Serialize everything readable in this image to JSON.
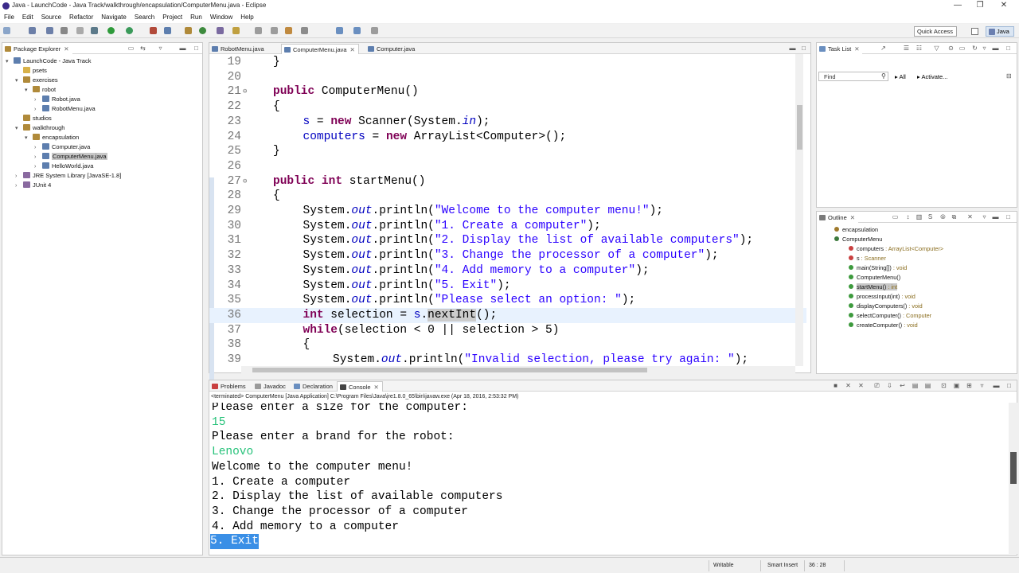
{
  "window": {
    "title": "Java - LaunchCode - Java Track/walkthrough/encapsulation/ComputerMenu.java - Eclipse",
    "minimize": "—",
    "maximize": "❐",
    "close": "✕"
  },
  "menu": [
    "File",
    "Edit",
    "Source",
    "Refactor",
    "Navigate",
    "Search",
    "Project",
    "Run",
    "Window",
    "Help"
  ],
  "toolbar": {
    "quick_access": "Quick Access",
    "perspective": "Java"
  },
  "package_explorer": {
    "title": "Package Explorer",
    "tree": [
      {
        "label": "LaunchCode - Java Track",
        "level": 0,
        "arrow": "▾",
        "icon": "project-icon"
      },
      {
        "label": "psets",
        "level": 1,
        "arrow": "",
        "icon": "folder-icon"
      },
      {
        "label": "exercises",
        "level": 1,
        "arrow": "▾",
        "icon": "package-icon"
      },
      {
        "label": "robot",
        "level": 2,
        "arrow": "▾",
        "icon": "package-icon"
      },
      {
        "label": "Robot.java",
        "level": 3,
        "arrow": "›",
        "icon": "java-file-icon"
      },
      {
        "label": "RobotMenu.java",
        "level": 3,
        "arrow": "›",
        "icon": "java-file-icon"
      },
      {
        "label": "studios",
        "level": 1,
        "arrow": "",
        "icon": "package-icon"
      },
      {
        "label": "walkthrough",
        "level": 1,
        "arrow": "▾",
        "icon": "package-icon"
      },
      {
        "label": "encapsulation",
        "level": 2,
        "arrow": "▾",
        "icon": "package-icon"
      },
      {
        "label": "Computer.java",
        "level": 3,
        "arrow": "›",
        "icon": "java-file-icon"
      },
      {
        "label": "ComputerMenu.java",
        "level": 3,
        "arrow": "›",
        "icon": "java-file-icon",
        "selected": true
      },
      {
        "label": "HelloWorld.java",
        "level": 3,
        "arrow": "›",
        "icon": "java-file-icon"
      },
      {
        "label": "JRE System Library [JavaSE-1.8]",
        "level": 1,
        "arrow": "›",
        "icon": "library-icon"
      },
      {
        "label": "JUnit 4",
        "level": 1,
        "arrow": "›",
        "icon": "library-icon"
      }
    ]
  },
  "editor": {
    "tabs": [
      {
        "label": "RobotMenu.java",
        "active": false
      },
      {
        "label": "ComputerMenu.java",
        "active": true
      },
      {
        "label": "Computer.java",
        "active": false
      }
    ],
    "lines": [
      {
        "n": "19",
        "fold": "",
        "indent": 0,
        "tokens": [
          [
            "",
            "}"
          ]
        ]
      },
      {
        "n": "20",
        "fold": "",
        "indent": 0,
        "tokens": []
      },
      {
        "n": "21",
        "fold": "⊖",
        "indent": 0,
        "tokens": [
          [
            "kw",
            "public"
          ],
          [
            "",
            " ComputerMenu()"
          ]
        ]
      },
      {
        "n": "22",
        "fold": "",
        "indent": 0,
        "tokens": [
          [
            "",
            "{"
          ]
        ]
      },
      {
        "n": "23",
        "fold": "",
        "indent": 1,
        "tokens": [
          [
            "fld",
            "s"
          ],
          [
            "",
            " = "
          ],
          [
            "kw",
            "new"
          ],
          [
            "",
            " Scanner(System."
          ],
          [
            "sfld",
            "in"
          ],
          [
            "",
            ");"
          ]
        ]
      },
      {
        "n": "24",
        "fold": "",
        "indent": 1,
        "tokens": [
          [
            "fld",
            "computers"
          ],
          [
            "",
            " = "
          ],
          [
            "kw",
            "new"
          ],
          [
            "",
            " ArrayList<Computer>();"
          ]
        ]
      },
      {
        "n": "25",
        "fold": "",
        "indent": 0,
        "tokens": [
          [
            "",
            "}"
          ]
        ]
      },
      {
        "n": "26",
        "fold": "",
        "indent": 0,
        "tokens": []
      },
      {
        "n": "27",
        "fold": "⊖",
        "indent": 0,
        "tokens": [
          [
            "kw",
            "public"
          ],
          [
            "",
            " "
          ],
          [
            "kw",
            "int"
          ],
          [
            "",
            " startMenu()"
          ]
        ]
      },
      {
        "n": "28",
        "fold": "",
        "indent": 0,
        "tokens": [
          [
            "",
            "{"
          ]
        ]
      },
      {
        "n": "29",
        "fold": "",
        "indent": 1,
        "tokens": [
          [
            "",
            "System."
          ],
          [
            "sfld",
            "out"
          ],
          [
            "",
            ".println("
          ],
          [
            "str",
            "\"Welcome to the computer menu!\""
          ],
          [
            "",
            ");"
          ]
        ]
      },
      {
        "n": "30",
        "fold": "",
        "indent": 1,
        "tokens": [
          [
            "",
            "System."
          ],
          [
            "sfld",
            "out"
          ],
          [
            "",
            ".println("
          ],
          [
            "str",
            "\"1. Create a computer\""
          ],
          [
            "",
            ");"
          ]
        ]
      },
      {
        "n": "31",
        "fold": "",
        "indent": 1,
        "tokens": [
          [
            "",
            "System."
          ],
          [
            "sfld",
            "out"
          ],
          [
            "",
            ".println("
          ],
          [
            "str",
            "\"2. Display the list of available computers\""
          ],
          [
            "",
            ");"
          ]
        ]
      },
      {
        "n": "32",
        "fold": "",
        "indent": 1,
        "tokens": [
          [
            "",
            "System."
          ],
          [
            "sfld",
            "out"
          ],
          [
            "",
            ".println("
          ],
          [
            "str",
            "\"3. Change the processor of a computer\""
          ],
          [
            "",
            ");"
          ]
        ]
      },
      {
        "n": "33",
        "fold": "",
        "indent": 1,
        "tokens": [
          [
            "",
            "System."
          ],
          [
            "sfld",
            "out"
          ],
          [
            "",
            ".println("
          ],
          [
            "str",
            "\"4. Add memory to a computer\""
          ],
          [
            "",
            ");"
          ]
        ]
      },
      {
        "n": "34",
        "fold": "",
        "indent": 1,
        "tokens": [
          [
            "",
            "System."
          ],
          [
            "sfld",
            "out"
          ],
          [
            "",
            ".println("
          ],
          [
            "str",
            "\"5. Exit\""
          ],
          [
            "",
            ");"
          ]
        ]
      },
      {
        "n": "35",
        "fold": "",
        "indent": 1,
        "tokens": [
          [
            "",
            "System."
          ],
          [
            "sfld",
            "out"
          ],
          [
            "",
            ".println("
          ],
          [
            "str",
            "\"Please select an option: \""
          ],
          [
            "",
            ");"
          ]
        ]
      },
      {
        "n": "36",
        "fold": "",
        "indent": 1,
        "current": true,
        "tokens": [
          [
            "kw",
            "int"
          ],
          [
            "",
            " selection = "
          ],
          [
            "fld",
            "s"
          ],
          [
            "",
            "."
          ],
          [
            "occ",
            "nextInt"
          ],
          [
            "",
            "();"
          ]
        ]
      },
      {
        "n": "37",
        "fold": "",
        "indent": 1,
        "tokens": [
          [
            "kw",
            "while"
          ],
          [
            "",
            "(selection < 0 || selection > 5)"
          ]
        ]
      },
      {
        "n": "38",
        "fold": "",
        "indent": 1,
        "tokens": [
          [
            "",
            "{"
          ]
        ]
      },
      {
        "n": "39",
        "fold": "",
        "indent": 2,
        "tokens": [
          [
            "",
            "System."
          ],
          [
            "sfld",
            "out"
          ],
          [
            "",
            ".println("
          ],
          [
            "str",
            "\"Invalid selection, please try again: \""
          ],
          [
            "",
            ");"
          ]
        ]
      }
    ]
  },
  "task_list": {
    "title": "Task List",
    "find_placeholder": "Find",
    "all": "All",
    "activate": "Activate..."
  },
  "outline": {
    "title": "Outline",
    "items": [
      {
        "label": "encapsulation",
        "type": "",
        "color": "#a07a2c",
        "level": 0
      },
      {
        "label": "ComputerMenu",
        "type": "",
        "color": "#3d7a3d",
        "level": 0
      },
      {
        "label": "computers",
        "type": " : ArrayList<Computer>",
        "color": "#c94040",
        "level": 1
      },
      {
        "label": "s",
        "type": " : Scanner",
        "color": "#c94040",
        "level": 1
      },
      {
        "label": "main(String[])",
        "type": " : void",
        "color": "#3d9a3d",
        "level": 1
      },
      {
        "label": "ComputerMenu()",
        "type": "",
        "color": "#3d9a3d",
        "level": 1
      },
      {
        "label": "startMenu()",
        "type": " : int",
        "color": "#3d9a3d",
        "level": 1,
        "selected": true
      },
      {
        "label": "processInput(int)",
        "type": " : void",
        "color": "#3d9a3d",
        "level": 1
      },
      {
        "label": "displayComputers()",
        "type": " : void",
        "color": "#3d9a3d",
        "level": 1
      },
      {
        "label": "selectComputer()",
        "type": " : Computer",
        "color": "#3d9a3d",
        "level": 1
      },
      {
        "label": "createComputer()",
        "type": " : void",
        "color": "#3d9a3d",
        "level": 1
      }
    ]
  },
  "bottom_panel": {
    "tabs": [
      {
        "label": "Problems",
        "active": false
      },
      {
        "label": "Javadoc",
        "active": false
      },
      {
        "label": "Declaration",
        "active": false
      },
      {
        "label": "Console",
        "active": true
      }
    ],
    "console_header": "<terminated> ComputerMenu [Java Application] C:\\Program Files\\Java\\jre1.8.0_65\\bin\\javaw.exe (Apr 18, 2016, 2:53:32 PM)",
    "console_lines": [
      {
        "text": "Please enter a size for the computer:",
        "kind": "out"
      },
      {
        "text": "15",
        "kind": "input"
      },
      {
        "text": "Please enter a brand for the robot:",
        "kind": "out"
      },
      {
        "text": "Lenovo",
        "kind": "input"
      },
      {
        "text": "Welcome to the computer menu!",
        "kind": "out"
      },
      {
        "text": "1. Create a computer",
        "kind": "out"
      },
      {
        "text": "2. Display the list of available computers",
        "kind": "out"
      },
      {
        "text": "3. Change the processor of a computer",
        "kind": "out"
      },
      {
        "text": "4. Add memory to a computer",
        "kind": "out"
      },
      {
        "text": "5. Exit",
        "kind": "highlight"
      }
    ]
  },
  "status": {
    "writable": "Writable",
    "insert_mode": "Smart Insert",
    "position": "36 : 28"
  },
  "colors": {
    "keyword": "#7f0055",
    "string": "#2a00ff",
    "field": "#0000c0",
    "console_input": "#27c27a",
    "selection": "#3a8fe6"
  }
}
